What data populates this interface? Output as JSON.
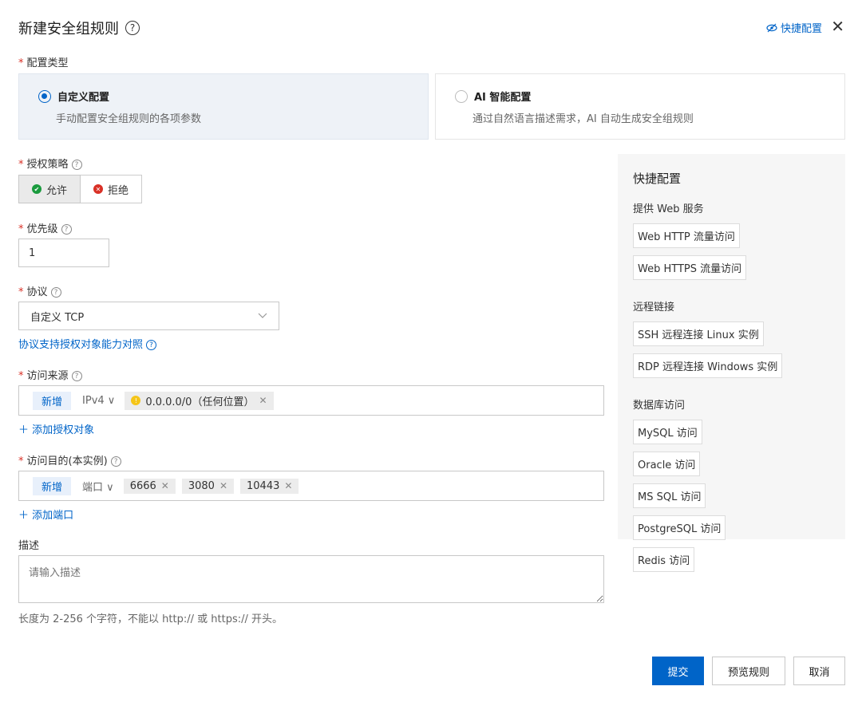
{
  "dialog": {
    "title": "新建安全组规则",
    "help": "?",
    "quick_config_link": "快捷配置",
    "close": "✕"
  },
  "config_type": {
    "label": "配置类型",
    "options": [
      {
        "title": "自定义配置",
        "desc": "手动配置安全组规则的各项参数",
        "selected": true
      },
      {
        "title": "AI 智能配置",
        "desc": "通过自然语言描述需求，AI 自动生成安全组规则",
        "selected": false
      }
    ]
  },
  "policy": {
    "label": "授权策略",
    "allow": "允许",
    "deny": "拒绝",
    "selected": "允许"
  },
  "priority": {
    "label": "优先级",
    "value": "1"
  },
  "protocol": {
    "label": "协议",
    "value": "自定义 TCP",
    "link": "协议支持授权对象能力对照"
  },
  "source": {
    "label": "访问来源",
    "new_tag": "新增",
    "ip_type": "IPv4",
    "chip": "0.0.0.0/0（任何位置）",
    "add_link": "添加授权对象"
  },
  "dest": {
    "label": "访问目的(本实例)",
    "new_tag": "新增",
    "type": "端口",
    "ports": [
      "6666",
      "3080",
      "10443"
    ],
    "add_link": "添加端口"
  },
  "desc": {
    "label": "描述",
    "placeholder": "请输入描述",
    "hint": "长度为 2-256 个字符，不能以 http:// 或 https:// 开头。"
  },
  "quick_panel": {
    "title": "快捷配置",
    "groups": [
      {
        "name": "提供 Web 服务",
        "items": [
          "Web HTTP 流量访问",
          "Web HTTPS 流量访问"
        ]
      },
      {
        "name": "远程链接",
        "items": [
          "SSH 远程连接 Linux 实例",
          "RDP 远程连接 Windows 实例"
        ]
      },
      {
        "name": "数据库访问",
        "items": [
          "MySQL 访问",
          "Oracle 访问",
          "MS SQL 访问",
          "PostgreSQL 访问",
          "Redis 访问"
        ]
      }
    ]
  },
  "footer": {
    "submit": "提交",
    "preview": "预览规则",
    "cancel": "取消"
  },
  "colors": {
    "primary": "#0064c8",
    "danger": "#d93026",
    "success": "#1a9b3e",
    "warning": "#f5c518"
  },
  "icons": {
    "close": "close-icon",
    "eye_off": "eye-off-icon",
    "help": "help-icon",
    "chevron": "chevron-down-icon",
    "plus": "plus-icon"
  }
}
